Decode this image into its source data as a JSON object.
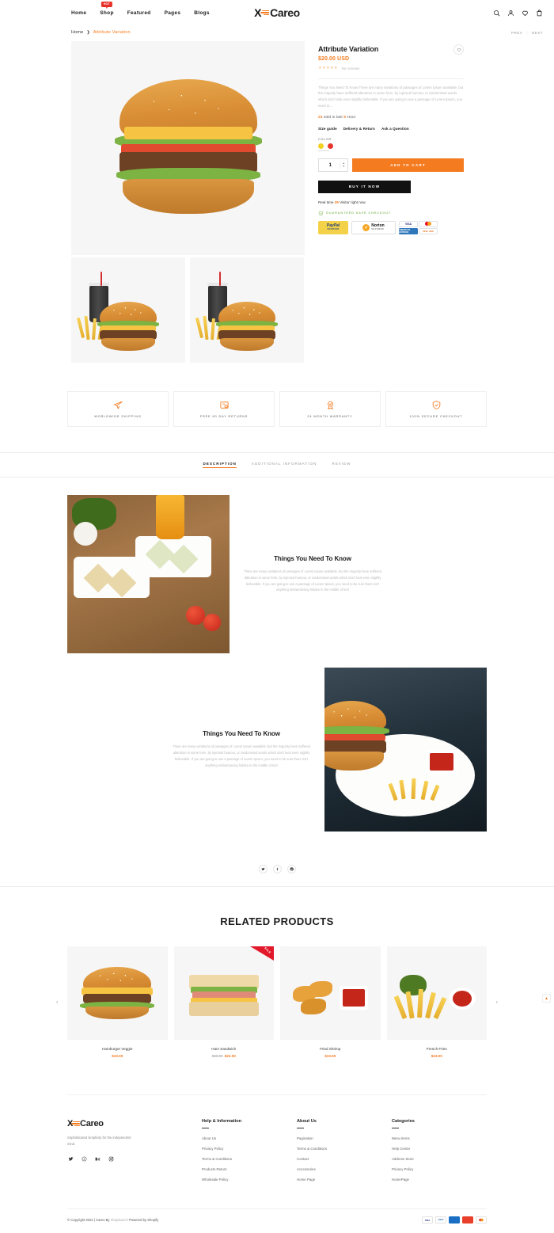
{
  "header": {
    "nav": [
      {
        "label": "Home",
        "badge": null
      },
      {
        "label": "Shop",
        "badge": "HOT"
      },
      {
        "label": "Featured",
        "badge": null
      },
      {
        "label": "Pages",
        "badge": null
      },
      {
        "label": "Blogs",
        "badge": null
      }
    ],
    "logo_x": "X",
    "logo_text": "Careo",
    "icons": [
      "search-icon",
      "account-icon",
      "wishlist-icon",
      "cart-icon"
    ]
  },
  "breadcrumb": {
    "home": "Home",
    "separator": "❯",
    "current": "Attribute Variation",
    "prev": "PREV",
    "next": "NEXT"
  },
  "product": {
    "title": "Attribute Variation",
    "price": "$20.00 USD",
    "stars": "★★★★★",
    "reviews_text": "No reviews",
    "description": "Things You Need To Know There are many variations of passages of Lorem Ipsum available, but the majority have suffered alteration in some form, by injected humour, or randomised words which don't look even slightly believable. If you are going to use a passage of Lorem Ipsum, you need to...",
    "sold_count": "23",
    "sold_prefix": "sold in last",
    "sold_hours": "9",
    "sold_suffix": "Hour",
    "links": [
      "Size guide",
      "Delivery & Return",
      "Ask a Question"
    ],
    "option_label": "COLOR",
    "swatches": [
      "#f2d024",
      "#e8362c"
    ],
    "quantity": "1",
    "add_to_cart": "ADD TO CART",
    "buy_now": "BUY IT NOW",
    "visitor_prefix": "Real time",
    "visitor_count": "29",
    "visitor_suffix": "Visitor right now",
    "safe_checkout": "GUARANTEED SAFE CHECKOUT",
    "payments": {
      "paypal_top": "PayPal",
      "paypal_bottom": "VERIFIED",
      "norton_title": "Norton",
      "norton_sub": "SECURED",
      "visa": "VISA",
      "amex": "AMERICAN EXPRESS",
      "discover": "DISC VER"
    }
  },
  "features": [
    {
      "icon": "plane-icon",
      "label": "WORLDWIDE SHIPPING"
    },
    {
      "icon": "return-box-icon",
      "label": "FREE 60 DAY RETURNS"
    },
    {
      "icon": "warranty-badge-icon",
      "label": "24 MONTH WARRANTY"
    },
    {
      "icon": "shield-check-icon",
      "label": "100% SECURE CHECKOUT"
    }
  ],
  "tabs": [
    {
      "label": "DESCRIPTION",
      "active": true
    },
    {
      "label": "ADDITIONAL INFORMATION",
      "active": false
    },
    {
      "label": "REVIEW",
      "active": false
    }
  ],
  "description_blocks": [
    {
      "title": "Things You Need To Know",
      "body": "There are many variations of passages of Lorem Ipsum available, but the majority have suffered alteration in some form, by injected humour, or randomised words which don't look even slightly believable. If you are going to use a passage of Lorem Ipsum, you need to be sure there isn't anything embarrassing hidden in the middle of text"
    },
    {
      "title": "Things You Need To Know",
      "body": "There are many variations of passages of Lorem Ipsum available, but the majority have suffered alteration in some form, by injected humour, or randomised words which don't look even slightly believable. If you are going to use a passage of Lorem Ipsum, you need to be sure there isn't anything embarrassing hidden in the middle of text"
    }
  ],
  "share": [
    "twitter-icon",
    "facebook-icon",
    "pinterest-icon"
  ],
  "related": {
    "title": "RELATED PRODUCTS",
    "prev_arrow": "‹",
    "next_arrow": "›",
    "items": [
      {
        "name": "Hamburger Veggie",
        "price": "$10.00",
        "old_price": null,
        "sale_badge": null
      },
      {
        "name": "Ham Sandwich",
        "price": "$23.00",
        "old_price": "$35.00",
        "sale_badge": "SALE"
      },
      {
        "name": "Fried Shrimp",
        "price": "$10.00",
        "old_price": null,
        "sale_badge": null
      },
      {
        "name": "French Fries",
        "price": "$23.00",
        "old_price": null,
        "sale_badge": null
      }
    ]
  },
  "footer": {
    "logo_x": "X",
    "logo_text": "Careo",
    "tagline": "Sophisticated simplicity for the independent mind",
    "social": [
      "twitter-icon",
      "pinterest-icon",
      "behance-icon",
      "instagram-icon"
    ],
    "columns": [
      {
        "heading": "Help & Information",
        "links": [
          "About Us",
          "Privacy Policy",
          "Terms & Conditions",
          "Products Return",
          "Wholesale Policy"
        ]
      },
      {
        "heading": "About Us",
        "links": [
          "Pagination",
          "Terms & Conditions",
          "Contact",
          "Accessories",
          "Home Page"
        ]
      },
      {
        "heading": "Categories",
        "links": [
          "Menu items",
          "Help Center",
          "Address Store",
          "Privacy Policy",
          "HomePage"
        ]
      }
    ],
    "copyright_main": "© Copyright 2022 | Careo By ",
    "copyright_link": "Shoplaunch",
    "copyright_tail": " Powered by Shopify",
    "cards": [
      "VISA",
      "AMEX",
      "",
      "",
      ""
    ]
  },
  "scroll_top": "▲"
}
